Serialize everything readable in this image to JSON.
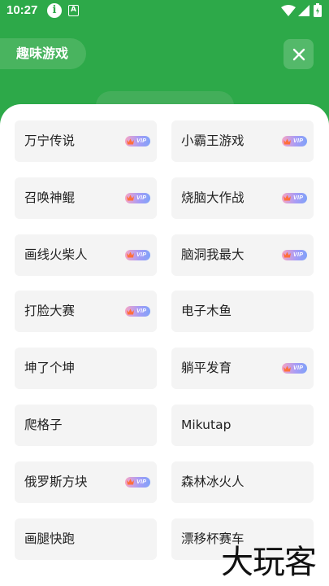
{
  "status_bar": {
    "time": "10:27",
    "info_glyph": "i",
    "a_glyph": "A",
    "icons": [
      "info-icon",
      "a-notification-icon",
      "wifi-icon",
      "signal-icon",
      "battery-icon"
    ]
  },
  "header": {
    "title": "趣味游戏",
    "close_icon": "close-icon"
  },
  "colors": {
    "header_green": "#2da949",
    "sheet_bg": "#ffffff",
    "item_bg": "#f4f4f4",
    "vip_gradient_start": "#f7a4c4",
    "vip_gradient_end": "#7fa2f8"
  },
  "vip_label": "VIP",
  "games": [
    {
      "name": "万宁传说",
      "vip": true
    },
    {
      "name": "小霸王游戏",
      "vip": true
    },
    {
      "name": "召唤神鲲",
      "vip": true
    },
    {
      "name": "烧脑大作战",
      "vip": true
    },
    {
      "name": "画线火柴人",
      "vip": true
    },
    {
      "name": "脑洞我最大",
      "vip": true
    },
    {
      "name": "打脸大赛",
      "vip": true
    },
    {
      "name": "电子木鱼",
      "vip": false
    },
    {
      "name": "坤了个坤",
      "vip": false
    },
    {
      "name": "躺平发育",
      "vip": true
    },
    {
      "name": "爬格子",
      "vip": false
    },
    {
      "name": "Mikutap",
      "vip": false
    },
    {
      "name": "俄罗斯方块",
      "vip": true
    },
    {
      "name": "森林冰火人",
      "vip": false
    },
    {
      "name": "画腿快跑",
      "vip": false
    },
    {
      "name": "漂移杯赛车",
      "vip": false
    }
  ],
  "watermark": "大玩客"
}
